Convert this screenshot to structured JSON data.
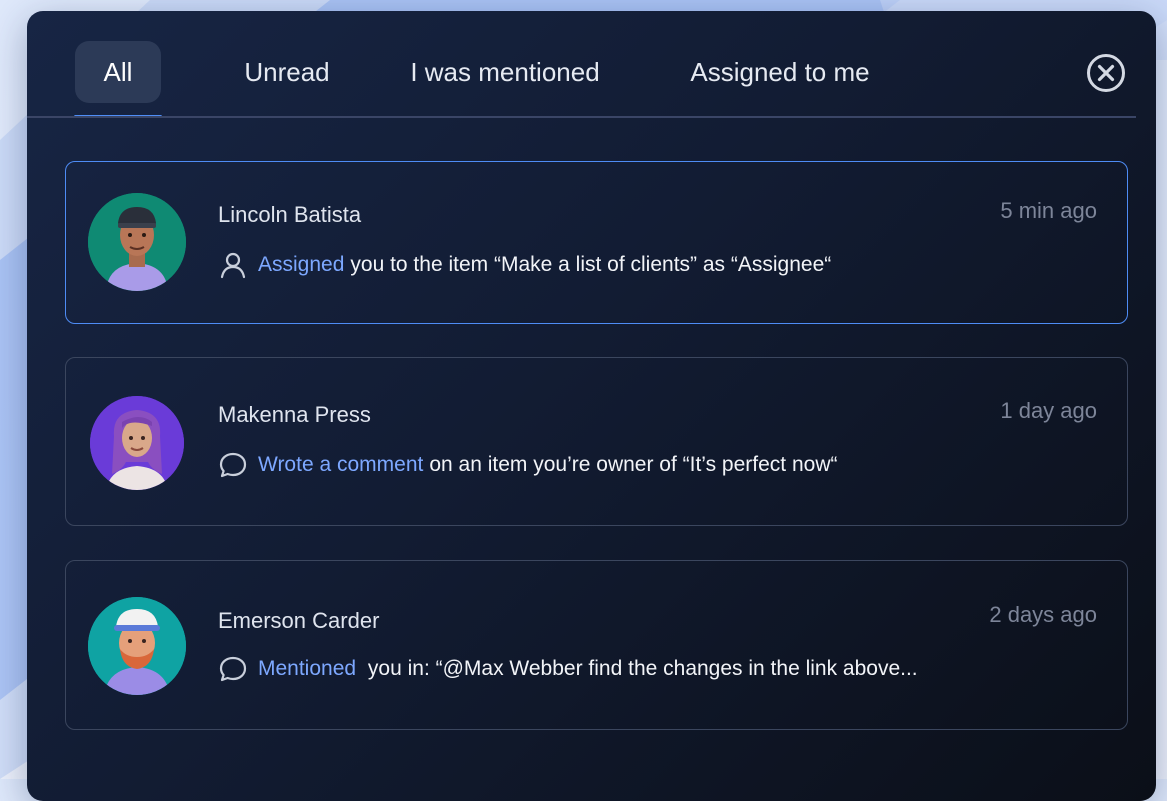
{
  "tabs": [
    {
      "label": "All",
      "active": true
    },
    {
      "label": "Unread",
      "active": false
    },
    {
      "label": "I was mentioned",
      "active": false
    },
    {
      "label": "Assigned to me",
      "active": false
    }
  ],
  "colors": {
    "accent": "#4f8ef7",
    "link": "#7da8ff",
    "panel_bg": "#121c33",
    "timestamp": "#7d8599"
  },
  "notifications": [
    {
      "name": "Lincoln Batista",
      "time": "5 min ago",
      "icon": "user-icon",
      "action": "Assigned",
      "text": "you to the item “Make a list of clients” as “Assignee“",
      "avatar_color": "#0f8a73",
      "highlighted": true
    },
    {
      "name": "Makenna Press",
      "time": "1 day ago",
      "icon": "comment-icon",
      "action": "Wrote a comment",
      "text": "on an item you’re owner of “It’s perfect now“",
      "avatar_color": "#6a3bd8",
      "highlighted": false
    },
    {
      "name": "Emerson Carder",
      "time": "2 days ago",
      "icon": "comment-icon",
      "action": "Mentioned",
      "text": " you in: “@Max Webber find the changes in the link above...",
      "avatar_color": "#0fa3a3",
      "highlighted": false
    }
  ]
}
